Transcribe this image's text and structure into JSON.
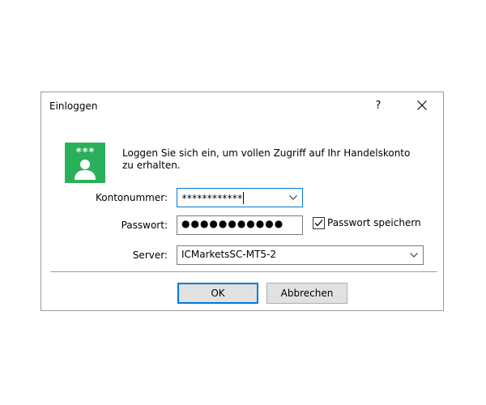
{
  "window": {
    "title": "Einloggen",
    "help_label": "?",
    "close_icon": "close-icon"
  },
  "icon": {
    "name": "account-login-icon",
    "stars": "***",
    "color": "#2ab05a"
  },
  "info": {
    "line1": "Loggen Sie sich ein, um vollen Zugriff auf Ihr Handelskonto",
    "line2": "zu erhalten."
  },
  "form": {
    "account": {
      "label": "Kontonummer:",
      "value": "************"
    },
    "password": {
      "label": "Passwort:",
      "value": "●●●●●●●●●●●"
    },
    "save_password": {
      "label": "Passwort speichern",
      "checked": true
    },
    "server": {
      "label": "Server:",
      "value": "ICMarketsSC-MT5-2"
    }
  },
  "buttons": {
    "ok": "OK",
    "cancel": "Abbrechen"
  },
  "colors": {
    "accent": "#0078d7",
    "button_bg": "#e1e1e1"
  }
}
